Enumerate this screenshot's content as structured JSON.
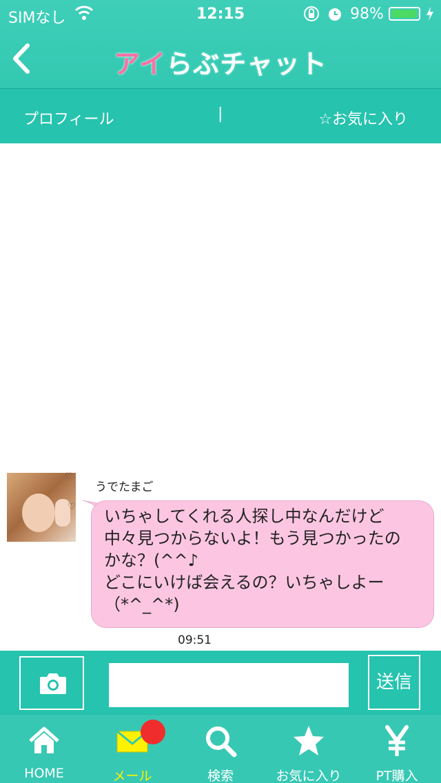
{
  "status": {
    "carrier": "SIMなし",
    "time": "12:15",
    "battery_pct": "98%",
    "battery_level": 0.98
  },
  "header": {
    "logo_pink": "アイ",
    "logo_rest": "らぶチャット"
  },
  "subnav": {
    "profile": "プロフィール",
    "separator": "|",
    "favorite": "☆お気に入り"
  },
  "chat": {
    "messages": [
      {
        "sender": "うでたまご",
        "text": "いちゃしてくれる人探し中なんだけど\n中々見つからないよ！もう見つかったの\nかな？(^^♪\nどこにいけば会えるの？いちゃしよー\n（*^_^*)",
        "time": "09:51"
      }
    ]
  },
  "input": {
    "value": "",
    "send_label": "送信"
  },
  "tabs": [
    {
      "label": "HOME",
      "icon": "home-icon"
    },
    {
      "label": "メール",
      "icon": "mail-icon",
      "active": true
    },
    {
      "label": "検索",
      "icon": "search-icon"
    },
    {
      "label": "お気に入り",
      "icon": "star-icon"
    },
    {
      "label": "PT購入",
      "icon": "yen-icon"
    }
  ],
  "colors": {
    "accent": "#33c8b1",
    "bubble": "#fcc6e2",
    "active_tab": "#fff200",
    "badge": "#f02d2d"
  }
}
